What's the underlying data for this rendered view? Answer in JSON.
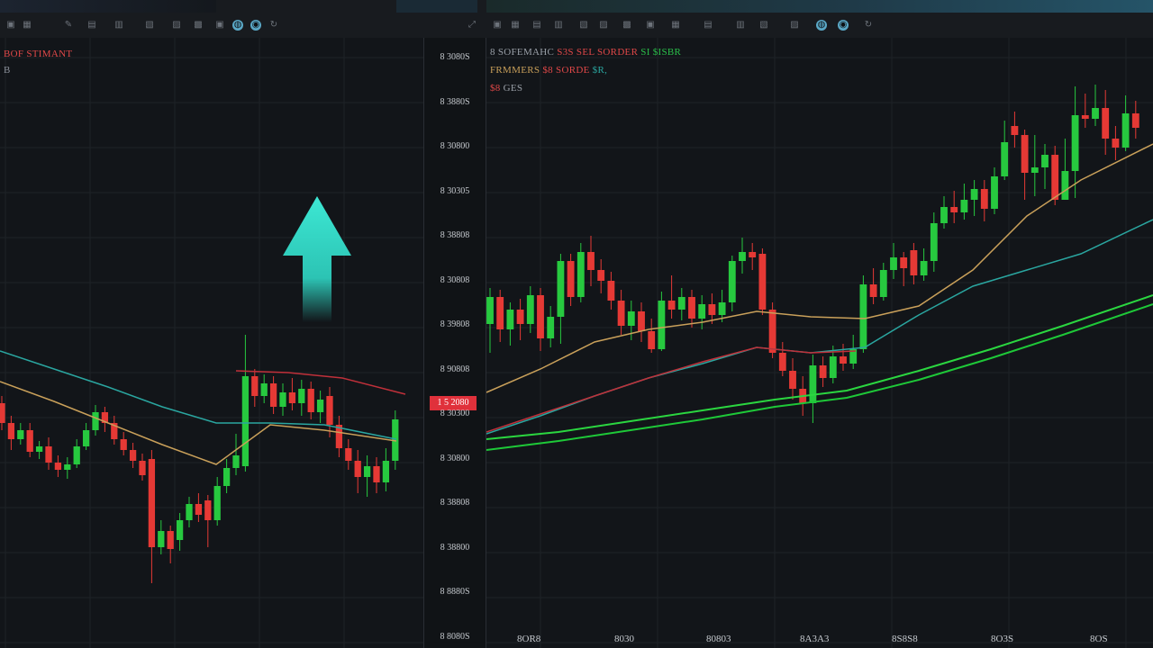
{
  "toolbar": {
    "icons": [
      "chart-icon",
      "indicator-icon",
      "draw-icon",
      "settings-icon",
      "alert-icon",
      "replay-icon",
      "layout-icon",
      "camera-icon",
      "share-icon",
      "globe-icon",
      "info-icon"
    ],
    "right_icons": [
      "layout-icon",
      "alert-icon",
      "replay-icon",
      "chart-icon",
      "draw-icon",
      "settings-icon",
      "camera-icon",
      "share-icon",
      "info-icon",
      "globe-icon",
      "info-icon"
    ]
  },
  "left_chart": {
    "legend_line1": "BOF STIMANT",
    "legend_line2": "B",
    "price_axis": [
      "8 3080S",
      "8 3880S",
      "8 30800",
      "8 30305",
      "8 38808",
      "8 30808",
      "8 39808",
      "8 90808",
      "8 30300",
      "8 30800",
      "8 38808",
      "8 38800",
      "8 8880S"
    ],
    "axis_bottom_label": "8 8080S",
    "last_price": "1 5 2080",
    "arrow_label": "up-arrow",
    "colors": {
      "up": "#27c93f",
      "down": "#e53935",
      "ma1": "#2aa6a0",
      "ma2": "#c9a05a",
      "ma3": "#c0303a",
      "arrow": "#3de8d4"
    },
    "candles": [
      {
        "o": 448,
        "c": 470,
        "h": 440,
        "l": 478
      },
      {
        "o": 470,
        "c": 488,
        "h": 462,
        "l": 500
      },
      {
        "o": 488,
        "c": 478,
        "h": 470,
        "l": 494
      },
      {
        "o": 478,
        "c": 502,
        "h": 470,
        "l": 508
      },
      {
        "o": 502,
        "c": 496,
        "h": 490,
        "l": 510
      },
      {
        "o": 496,
        "c": 514,
        "h": 486,
        "l": 522
      },
      {
        "o": 514,
        "c": 522,
        "h": 506,
        "l": 530
      },
      {
        "o": 522,
        "c": 516,
        "h": 508,
        "l": 532
      },
      {
        "o": 516,
        "c": 496,
        "h": 488,
        "l": 520
      },
      {
        "o": 496,
        "c": 478,
        "h": 470,
        "l": 500
      },
      {
        "o": 478,
        "c": 458,
        "h": 450,
        "l": 484
      },
      {
        "o": 458,
        "c": 470,
        "h": 452,
        "l": 480
      },
      {
        "o": 470,
        "c": 488,
        "h": 462,
        "l": 494
      },
      {
        "o": 488,
        "c": 500,
        "h": 480,
        "l": 506
      },
      {
        "o": 500,
        "c": 512,
        "h": 492,
        "l": 520
      },
      {
        "o": 512,
        "c": 528,
        "h": 504,
        "l": 534
      },
      {
        "o": 510,
        "c": 608,
        "h": 500,
        "l": 648
      },
      {
        "o": 608,
        "c": 590,
        "h": 578,
        "l": 616
      },
      {
        "o": 590,
        "c": 610,
        "h": 584,
        "l": 626
      },
      {
        "o": 600,
        "c": 578,
        "h": 570,
        "l": 612
      },
      {
        "o": 578,
        "c": 560,
        "h": 552,
        "l": 586
      },
      {
        "o": 560,
        "c": 572,
        "h": 548,
        "l": 580
      },
      {
        "o": 556,
        "c": 578,
        "h": 550,
        "l": 608
      },
      {
        "o": 578,
        "c": 540,
        "h": 530,
        "l": 584
      },
      {
        "o": 540,
        "c": 520,
        "h": 510,
        "l": 548
      },
      {
        "o": 520,
        "c": 506,
        "h": 482,
        "l": 528
      },
      {
        "o": 518,
        "c": 418,
        "h": 372,
        "l": 524
      },
      {
        "o": 418,
        "c": 440,
        "h": 410,
        "l": 452
      },
      {
        "o": 440,
        "c": 426,
        "h": 416,
        "l": 448
      },
      {
        "o": 426,
        "c": 452,
        "h": 418,
        "l": 460
      },
      {
        "o": 452,
        "c": 436,
        "h": 426,
        "l": 462
      },
      {
        "o": 436,
        "c": 448,
        "h": 420,
        "l": 456
      },
      {
        "o": 448,
        "c": 432,
        "h": 422,
        "l": 462
      },
      {
        "o": 432,
        "c": 458,
        "h": 424,
        "l": 466
      },
      {
        "o": 458,
        "c": 444,
        "h": 434,
        "l": 470
      },
      {
        "o": 440,
        "c": 472,
        "h": 430,
        "l": 486
      },
      {
        "o": 472,
        "c": 498,
        "h": 462,
        "l": 508
      },
      {
        "o": 498,
        "c": 512,
        "h": 488,
        "l": 522
      },
      {
        "o": 512,
        "c": 530,
        "h": 500,
        "l": 548
      },
      {
        "o": 530,
        "c": 518,
        "h": 506,
        "l": 552
      },
      {
        "o": 518,
        "c": 536,
        "h": 508,
        "l": 548
      },
      {
        "o": 536,
        "c": 512,
        "h": 498,
        "l": 546
      },
      {
        "o": 512,
        "c": 466,
        "h": 456,
        "l": 522
      }
    ]
  },
  "right_chart": {
    "legend_line1": [
      "8 SOFEMAHC",
      "S3S SEL",
      "SORDER",
      "SI $ISBR"
    ],
    "legend_line2": [
      "FRMMERS",
      "$8",
      "SORDE",
      "$R,"
    ],
    "legend_line3": [
      "$8",
      "GES"
    ],
    "time_axis": [
      "8OR8",
      "8030",
      "80803",
      "8A3A3",
      "8S8S8",
      "8O3S",
      "8OS"
    ],
    "candles": [
      {
        "o": 360,
        "c": 330,
        "h": 320,
        "l": 392
      },
      {
        "o": 330,
        "c": 366,
        "h": 322,
        "l": 380
      },
      {
        "o": 366,
        "c": 344,
        "h": 336,
        "l": 384
      },
      {
        "o": 344,
        "c": 360,
        "h": 332,
        "l": 378
      },
      {
        "o": 360,
        "c": 328,
        "h": 318,
        "l": 370
      },
      {
        "o": 328,
        "c": 376,
        "h": 320,
        "l": 390
      },
      {
        "o": 376,
        "c": 352,
        "h": 340,
        "l": 386
      },
      {
        "o": 352,
        "c": 290,
        "h": 282,
        "l": 382
      },
      {
        "o": 290,
        "c": 330,
        "h": 282,
        "l": 340
      },
      {
        "o": 330,
        "c": 280,
        "h": 270,
        "l": 336
      },
      {
        "o": 280,
        "c": 300,
        "h": 262,
        "l": 318
      },
      {
        "o": 300,
        "c": 312,
        "h": 288,
        "l": 326
      },
      {
        "o": 312,
        "c": 334,
        "h": 302,
        "l": 344
      },
      {
        "o": 334,
        "c": 362,
        "h": 322,
        "l": 372
      },
      {
        "o": 362,
        "c": 346,
        "h": 334,
        "l": 378
      },
      {
        "o": 346,
        "c": 368,
        "h": 336,
        "l": 380
      },
      {
        "o": 368,
        "c": 388,
        "h": 354,
        "l": 392
      },
      {
        "o": 388,
        "c": 334,
        "h": 324,
        "l": 390
      },
      {
        "o": 334,
        "c": 344,
        "h": 306,
        "l": 354
      },
      {
        "o": 344,
        "c": 330,
        "h": 320,
        "l": 356
      },
      {
        "o": 330,
        "c": 354,
        "h": 322,
        "l": 364
      },
      {
        "o": 354,
        "c": 338,
        "h": 328,
        "l": 366
      },
      {
        "o": 338,
        "c": 350,
        "h": 326,
        "l": 360
      },
      {
        "o": 350,
        "c": 336,
        "h": 322,
        "l": 358
      },
      {
        "o": 336,
        "c": 290,
        "h": 284,
        "l": 346
      },
      {
        "o": 290,
        "c": 280,
        "h": 264,
        "l": 304
      },
      {
        "o": 280,
        "c": 286,
        "h": 270,
        "l": 300
      },
      {
        "o": 282,
        "c": 344,
        "h": 276,
        "l": 350
      },
      {
        "o": 344,
        "c": 392,
        "h": 336,
        "l": 398
      },
      {
        "o": 392,
        "c": 412,
        "h": 380,
        "l": 418
      },
      {
        "o": 412,
        "c": 432,
        "h": 398,
        "l": 444
      },
      {
        "o": 432,
        "c": 448,
        "h": 418,
        "l": 462
      },
      {
        "o": 448,
        "c": 406,
        "h": 394,
        "l": 470
      },
      {
        "o": 406,
        "c": 420,
        "h": 396,
        "l": 430
      },
      {
        "o": 420,
        "c": 396,
        "h": 384,
        "l": 426
      },
      {
        "o": 396,
        "c": 404,
        "h": 382,
        "l": 412
      },
      {
        "o": 404,
        "c": 388,
        "h": 372,
        "l": 410
      },
      {
        "o": 388,
        "c": 316,
        "h": 306,
        "l": 392
      },
      {
        "o": 316,
        "c": 330,
        "h": 298,
        "l": 338
      },
      {
        "o": 330,
        "c": 300,
        "h": 292,
        "l": 334
      },
      {
        "o": 300,
        "c": 286,
        "h": 270,
        "l": 310
      },
      {
        "o": 286,
        "c": 298,
        "h": 280,
        "l": 318
      },
      {
        "o": 278,
        "c": 306,
        "h": 270,
        "l": 316
      },
      {
        "o": 306,
        "c": 290,
        "h": 276,
        "l": 312
      },
      {
        "o": 290,
        "c": 248,
        "h": 236,
        "l": 302
      },
      {
        "o": 248,
        "c": 230,
        "h": 218,
        "l": 254
      },
      {
        "o": 230,
        "c": 236,
        "h": 212,
        "l": 248
      },
      {
        "o": 236,
        "c": 222,
        "h": 204,
        "l": 244
      },
      {
        "o": 222,
        "c": 210,
        "h": 200,
        "l": 240
      },
      {
        "o": 210,
        "c": 232,
        "h": 200,
        "l": 246
      },
      {
        "o": 232,
        "c": 196,
        "h": 186,
        "l": 238
      },
      {
        "o": 196,
        "c": 158,
        "h": 134,
        "l": 200
      },
      {
        "o": 140,
        "c": 150,
        "h": 124,
        "l": 164
      },
      {
        "o": 150,
        "c": 192,
        "h": 144,
        "l": 222
      },
      {
        "o": 192,
        "c": 186,
        "h": 150,
        "l": 218
      },
      {
        "o": 186,
        "c": 172,
        "h": 160,
        "l": 210
      },
      {
        "o": 172,
        "c": 222,
        "h": 162,
        "l": 228
      },
      {
        "o": 222,
        "c": 190,
        "h": 154,
        "l": 220
      },
      {
        "o": 190,
        "c": 128,
        "h": 96,
        "l": 220
      },
      {
        "o": 128,
        "c": 132,
        "h": 104,
        "l": 142
      },
      {
        "o": 132,
        "c": 120,
        "h": 94,
        "l": 140
      },
      {
        "o": 120,
        "c": 154,
        "h": 100,
        "l": 172
      },
      {
        "o": 154,
        "c": 164,
        "h": 140,
        "l": 178
      },
      {
        "o": 164,
        "c": 126,
        "h": 106,
        "l": 168
      },
      {
        "o": 126,
        "c": 142,
        "h": 112,
        "l": 154
      }
    ]
  }
}
